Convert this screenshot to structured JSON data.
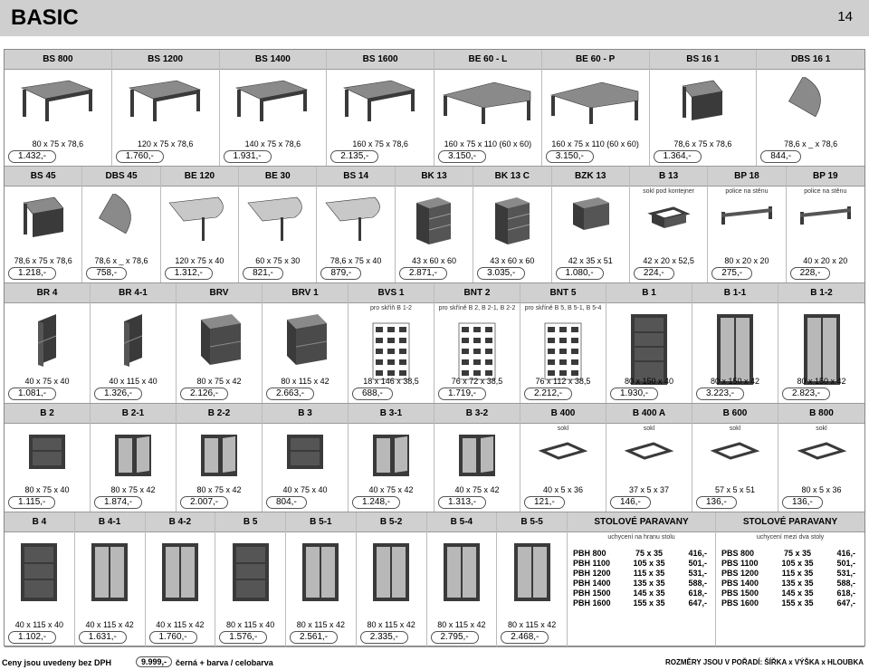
{
  "header": {
    "title": "BASIC",
    "page_number": "14"
  },
  "rows": [
    {
      "cells": [
        {
          "code": "BS 800",
          "dims": "80 x 75 x 78,6",
          "price": "1.432,-",
          "kind": "desk"
        },
        {
          "code": "BS 1200",
          "dims": "120 x 75 x 78,6",
          "price": "1.760,-",
          "kind": "desk"
        },
        {
          "code": "BS 1400",
          "dims": "140 x 75 x 78,6",
          "price": "1.931,-",
          "kind": "desk"
        },
        {
          "code": "BS 1600",
          "dims": "160 x 75 x 78,6",
          "price": "2.135,-",
          "kind": "desk"
        },
        {
          "code": "BE 60 - L",
          "dims": "160 x 75 x 110 (60 x 60)",
          "price": "3.150,-",
          "kind": "corner-desk"
        },
        {
          "code": "BE 60 - P",
          "dims": "160 x 75 x 110 (60 x 60)",
          "price": "3.150,-",
          "kind": "corner-desk"
        },
        {
          "code": "BS 16 1",
          "dims": "78,6 x 75 x 78,6",
          "price": "1.364,-",
          "kind": "corner-table"
        },
        {
          "code": "DBS 16 1",
          "dims": "78,6 x _ x 78,6",
          "price": "844,-",
          "kind": "quarter-top"
        }
      ]
    },
    {
      "cells": [
        {
          "code": "BS 45",
          "dims": "78,6 x 75 x 78,6",
          "price": "1.218,-",
          "kind": "corner-table"
        },
        {
          "code": "DBS 45",
          "dims": "78,6 x _ x 78,6",
          "price": "758,-",
          "kind": "quarter-top"
        },
        {
          "code": "BE 120",
          "dims": "120 x 75 x 40",
          "price": "1.312,-",
          "kind": "extension"
        },
        {
          "code": "BE 30",
          "dims": "60 x 75 x 30",
          "price": "821,-",
          "kind": "extension"
        },
        {
          "code": "BS 14",
          "dims": "78,6 x 75 x 40",
          "price": "879,-",
          "kind": "extension"
        },
        {
          "code": "BK 13",
          "dims": "43 x 60 x 60",
          "price": "2.871,-",
          "kind": "drawers"
        },
        {
          "code": "BK 13 C",
          "dims": "43 x 60 x 60",
          "price": "3.035,-",
          "kind": "drawers"
        },
        {
          "code": "BZK 13",
          "dims": "42 x 35 x 51",
          "price": "1.080,-",
          "kind": "hanging-drawers"
        },
        {
          "code": "B 13",
          "sub": "sokl pod kontejner",
          "dims": "42 x 20 x 52,5",
          "price": "224,-",
          "kind": "base"
        },
        {
          "code": "BP 18",
          "sub": "police na stěnu",
          "dims": "80 x 20 x 20",
          "price": "275,-",
          "kind": "shelf"
        },
        {
          "code": "BP 19",
          "sub": "police na stěnu",
          "dims": "40 x 20 x 20",
          "price": "228,-",
          "kind": "shelf"
        }
      ]
    },
    {
      "cells": [
        {
          "code": "BR 4",
          "dims": "40 x 75 x 40",
          "price": "1.081,-",
          "kind": "corner-cab"
        },
        {
          "code": "BR 4-1",
          "dims": "40 x 115 x 40",
          "price": "1.326,-",
          "kind": "corner-cab"
        },
        {
          "code": "BRV",
          "dims": "80 x 75 x 42",
          "price": "2.126,-",
          "kind": "box-cab"
        },
        {
          "code": "BRV 1",
          "dims": "80 x 115 x 42",
          "price": "2.663,-",
          "kind": "box-cab"
        },
        {
          "code": "BVS 1",
          "sub": "pro skříň B 1-2",
          "dims": "18 x 146 x 38,5",
          "price": "688,-",
          "kind": "rack"
        },
        {
          "code": "BNT 2",
          "sub": "pro skříně B 2, B 2-1, B 2-2",
          "dims": "76 x 72 x 38,5",
          "price": "1.719,-",
          "kind": "rack"
        },
        {
          "code": "BNT 5",
          "sub": "pro skříně B 5, B 5-1, B 5-4",
          "dims": "76 x 112 x 38,5",
          "price": "2.212,-",
          "kind": "rack"
        },
        {
          "code": "B 1",
          "dims": "80 x 150 x 40",
          "price": "1.930,-",
          "kind": "tall-open"
        },
        {
          "code": "B 1-1",
          "dims": "80 x 150 x 42",
          "price": "3.223,-",
          "kind": "tall-doors"
        },
        {
          "code": "B 1-2",
          "dims": "80 x 150 x 42",
          "price": "2.823,-",
          "kind": "tall-doors"
        }
      ]
    },
    {
      "cells": [
        {
          "code": "B 2",
          "dims": "80 x 75 x 40",
          "price": "1.115,-",
          "kind": "low-open"
        },
        {
          "code": "B 2-1",
          "dims": "80 x 75 x 42",
          "price": "1.874,-",
          "kind": "low-doors"
        },
        {
          "code": "B 2-2",
          "dims": "80 x 75 x 42",
          "price": "2.007,-",
          "kind": "low-doors"
        },
        {
          "code": "B 3",
          "dims": "40 x 75 x 40",
          "price": "804,-",
          "kind": "low-open"
        },
        {
          "code": "B 3-1",
          "dims": "40 x 75 x 42",
          "price": "1.248,-",
          "kind": "low-doors"
        },
        {
          "code": "B 3-2",
          "dims": "40 x 75 x 42",
          "price": "1.313,-",
          "kind": "low-doors"
        },
        {
          "code": "B 400",
          "sub": "sokl",
          "dims": "40 x 5 x 36",
          "price": "121,-",
          "kind": "frame"
        },
        {
          "code": "B 400 A",
          "sub": "sokl",
          "dims": "37 x 5 x 37",
          "price": "146,-",
          "kind": "frame"
        },
        {
          "code": "B 600",
          "sub": "sokl",
          "dims": "57 x 5 x 51",
          "price": "136,-",
          "kind": "frame"
        },
        {
          "code": "B 800",
          "sub": "sokl",
          "dims": "80 x 5 x 36",
          "price": "136,-",
          "kind": "frame"
        }
      ]
    },
    {
      "cells": [
        {
          "code": "B 4",
          "dims": "40 x 115 x 40",
          "price": "1.102,-",
          "kind": "mid-open"
        },
        {
          "code": "B 4-1",
          "dims": "40 x 115 x 42",
          "price": "1.631,-",
          "kind": "mid-doors"
        },
        {
          "code": "B 4-2",
          "dims": "40 x 115 x 42",
          "price": "1.760,-",
          "kind": "mid-doors"
        },
        {
          "code": "B 5",
          "dims": "80 x 115 x 40",
          "price": "1.576,-",
          "kind": "mid-open"
        },
        {
          "code": "B 5-1",
          "dims": "80 x 115 x 42",
          "price": "2.561,-",
          "kind": "mid-doors"
        },
        {
          "code": "B 5-2",
          "dims": "80 x 115 x 42",
          "price": "2.335,-",
          "kind": "mid-doors"
        },
        {
          "code": "B 5-4",
          "dims": "80 x 115 x 42",
          "price": "2.795,-",
          "kind": "mid-doors"
        },
        {
          "code": "B 5-5",
          "dims": "80 x 115 x 42",
          "price": "2.468,-",
          "kind": "mid-doors"
        }
      ],
      "paravany": [
        {
          "title": "STOLOVÉ PARAVANY",
          "sub": "uchycení na hranu stolu",
          "items": [
            {
              "code": "PBH 800",
              "dims": "75 x 35",
              "price": "416,-"
            },
            {
              "code": "PBH 1100",
              "dims": "105 x 35",
              "price": "501,-"
            },
            {
              "code": "PBH 1200",
              "dims": "115 x 35",
              "price": "531,-"
            },
            {
              "code": "PBH 1400",
              "dims": "135 x 35",
              "price": "588,-"
            },
            {
              "code": "PBH 1500",
              "dims": "145 x 35",
              "price": "618,-"
            },
            {
              "code": "PBH 1600",
              "dims": "155 x 35",
              "price": "647,-"
            }
          ]
        },
        {
          "title": "STOLOVÉ PARAVANY",
          "sub": "uchycení mezi dva stoly",
          "items": [
            {
              "code": "PBS 800",
              "dims": "75 x 35",
              "price": "416,-"
            },
            {
              "code": "PBS 1100",
              "dims": "105 x 35",
              "price": "501,-"
            },
            {
              "code": "PBS 1200",
              "dims": "115 x 35",
              "price": "531,-"
            },
            {
              "code": "PBS 1400",
              "dims": "135 x 35",
              "price": "588,-"
            },
            {
              "code": "PBS 1500",
              "dims": "145 x 35",
              "price": "618,-"
            },
            {
              "code": "PBS 1600",
              "dims": "155 x 35",
              "price": "647,-"
            }
          ]
        }
      ]
    }
  ],
  "footer": {
    "note": "Ceny jsou uvedeny bez DPH",
    "price_example": "9.999,-",
    "color_note": "černá + barva / celobarva",
    "dims_order": "ROZMĚRY JSOU V POŘADÍ:  ŠÍŘKA x VÝŠKA x HLOUBKA"
  },
  "colors": {
    "header_bg": "#cfcfcf",
    "cell_head_bg": "#d0d0d0",
    "furniture_dark": "#3a3a3a",
    "furniture_top": "#8a8a8a",
    "door_grey": "#b8b8b8"
  }
}
